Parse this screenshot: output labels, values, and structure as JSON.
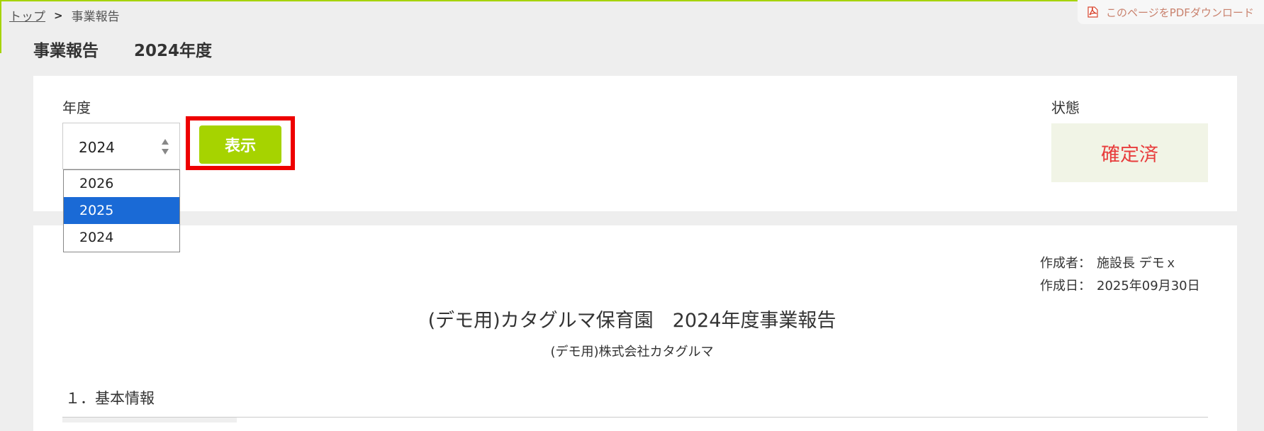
{
  "breadcrumb": {
    "home_label": "トップ",
    "separator": ">",
    "current_label": "事業報告"
  },
  "pdf_download": {
    "label": "このページをPDFダウンロード",
    "icon": "pdf-icon"
  },
  "page_title": {
    "main": "事業報告",
    "year": "2024年度"
  },
  "filter": {
    "year_label": "年度",
    "selected_year": "2024",
    "options": [
      "2026",
      "2025",
      "2024"
    ],
    "highlighted_option": "2025",
    "show_button_label": "表示"
  },
  "status": {
    "label": "状態",
    "value": "確定済"
  },
  "document": {
    "author_label": "作成者：",
    "author_value": "施設長 デモｘ",
    "date_label": "作成日：",
    "date_value": "2025年09月30日",
    "title": "(デモ用)カタグルマ保育園　2024年度事業報告",
    "subtitle": "(デモ用)株式会社カタグルマ",
    "section_1": "１．基本情報"
  },
  "colors": {
    "accent": "#a6d300",
    "highlight": "#ee0000",
    "status_text": "#e83c3c",
    "selected_option": "#1a6ad6"
  }
}
